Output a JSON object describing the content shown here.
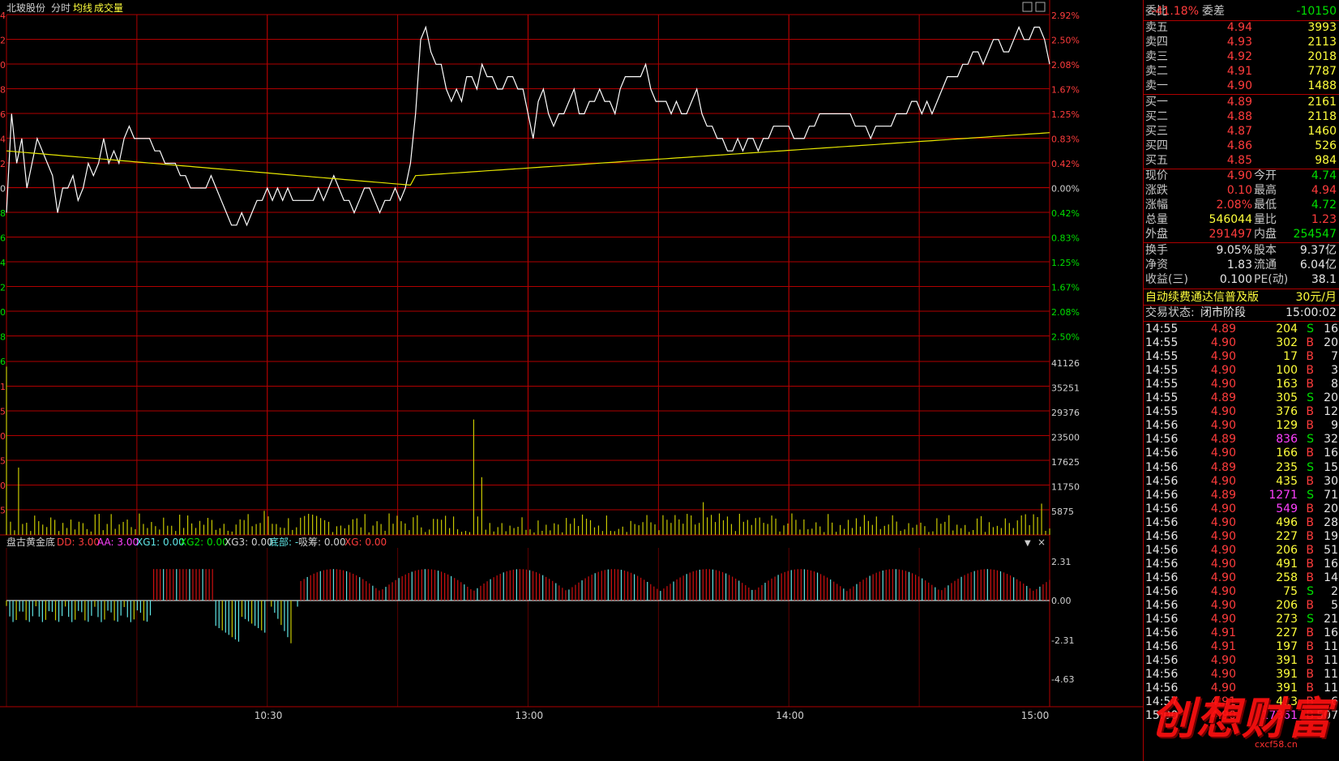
{
  "header": {
    "stock_name": "北玻股份",
    "tab_intraday": "分时",
    "avg_line_label": "均线",
    "volume_label": "成交量"
  },
  "indicator": {
    "name": "盘古黄金底",
    "dd": "DD: 3.00",
    "aa": "AA: 3.00",
    "xg1": "XG1: 0.00",
    "xg2": "XG2: 0.00",
    "xg3": "XG3: 0.00",
    "bottom": "底部: -",
    "absorb": "吸筹: 0.00",
    "xg": "XG: 0.00",
    "axis": [
      "2.31",
      "0.00",
      "-2.31",
      "-4.63"
    ]
  },
  "time_axis": [
    "10:30",
    "13:00",
    "14:00",
    "15:00"
  ],
  "price_axis_left": [
    "4",
    "2",
    "0",
    "8",
    "6",
    "4",
    "2",
    "0",
    "8",
    "6",
    "4",
    "2",
    "0",
    "8",
    "6"
  ],
  "pct_axis": [
    "2.92%",
    "2.50%",
    "2.08%",
    "1.67%",
    "1.25%",
    "0.83%",
    "0.42%",
    "0.00%",
    "0.42%",
    "0.83%",
    "1.25%",
    "1.67%",
    "2.08%",
    "2.50%"
  ],
  "volume_axis": [
    "41126",
    "35251",
    "29376",
    "23500",
    "17625",
    "11750",
    "5875"
  ],
  "volume_axis_left": [
    "1",
    "5",
    "0",
    "5",
    "0",
    "5"
  ],
  "chart_data": {
    "type": "line",
    "price_series_name": "分时",
    "avg_series_name": "均线",
    "base_price": 4.8,
    "price": [
      4.78,
      4.86,
      4.82,
      4.84,
      4.8,
      4.82,
      4.84,
      4.83,
      4.82,
      4.81,
      4.78,
      4.8,
      4.8,
      4.81,
      4.79,
      4.8,
      4.82,
      4.81,
      4.82,
      4.84,
      4.82,
      4.83,
      4.82,
      4.84,
      4.85,
      4.84,
      4.84,
      4.84,
      4.84,
      4.83,
      4.83,
      4.82,
      4.82,
      4.82,
      4.81,
      4.81,
      4.8,
      4.8,
      4.8,
      4.8,
      4.81,
      4.8,
      4.79,
      4.78,
      4.77,
      4.77,
      4.78,
      4.77,
      4.78,
      4.79,
      4.79,
      4.8,
      4.79,
      4.8,
      4.79,
      4.8,
      4.79,
      4.79,
      4.79,
      4.79,
      4.79,
      4.8,
      4.79,
      4.8,
      4.81,
      4.8,
      4.79,
      4.79,
      4.78,
      4.79,
      4.8,
      4.8,
      4.79,
      4.78,
      4.79,
      4.79,
      4.8,
      4.79,
      4.8,
      4.82,
      4.86,
      4.92,
      4.93,
      4.91,
      4.9,
      4.9,
      4.88,
      4.87,
      4.88,
      4.87,
      4.89,
      4.89,
      4.88,
      4.9,
      4.89,
      4.89,
      4.88,
      4.88,
      4.89,
      4.89,
      4.88,
      4.88,
      4.86,
      4.84,
      4.87,
      4.88,
      4.86,
      4.85,
      4.86,
      4.86,
      4.87,
      4.88,
      4.86,
      4.86,
      4.87,
      4.87,
      4.88,
      4.87,
      4.87,
      4.86,
      4.88,
      4.89,
      4.89,
      4.89,
      4.89,
      4.9,
      4.88,
      4.87,
      4.87,
      4.87,
      4.86,
      4.87,
      4.86,
      4.86,
      4.87,
      4.88,
      4.86,
      4.85,
      4.85,
      4.84,
      4.84,
      4.83,
      4.83,
      4.84,
      4.83,
      4.84,
      4.84,
      4.83,
      4.84,
      4.84,
      4.85,
      4.85,
      4.85,
      4.85,
      4.84,
      4.84,
      4.84,
      4.85,
      4.85,
      4.86,
      4.86,
      4.86,
      4.86,
      4.86,
      4.86,
      4.86,
      4.85,
      4.85,
      4.85,
      4.84,
      4.85,
      4.85,
      4.85,
      4.85,
      4.86,
      4.86,
      4.86,
      4.87,
      4.87,
      4.86,
      4.87,
      4.86,
      4.87,
      4.88,
      4.89,
      4.89,
      4.89,
      4.9,
      4.9,
      4.91,
      4.91,
      4.9,
      4.91,
      4.92,
      4.92,
      4.91,
      4.91,
      4.92,
      4.93,
      4.92,
      4.92,
      4.93,
      4.93,
      4.92,
      4.9
    ],
    "avg_start": 4.83,
    "avg_end": 4.835,
    "pct_ticks": [
      2.92,
      2.5,
      2.08,
      1.67,
      1.25,
      0.83,
      0.42,
      0.0,
      -0.42,
      -0.83,
      -1.25,
      -1.67,
      -2.08,
      -2.5
    ],
    "volume_max": 41126
  },
  "sidebar": {
    "weibi_label": "委比",
    "weibi_value": "-41.18%",
    "weicha_label": "委差",
    "weicha_value": "-10150",
    "sells": [
      {
        "label": "卖五",
        "price": "4.94",
        "vol": "3993"
      },
      {
        "label": "卖四",
        "price": "4.93",
        "vol": "2113"
      },
      {
        "label": "卖三",
        "price": "4.92",
        "vol": "2018"
      },
      {
        "label": "卖二",
        "price": "4.91",
        "vol": "7787"
      },
      {
        "label": "卖一",
        "price": "4.90",
        "vol": "1488"
      }
    ],
    "buys": [
      {
        "label": "买一",
        "price": "4.89",
        "vol": "2161"
      },
      {
        "label": "买二",
        "price": "4.88",
        "vol": "2118"
      },
      {
        "label": "买三",
        "price": "4.87",
        "vol": "1460"
      },
      {
        "label": "买四",
        "price": "4.86",
        "vol": "526"
      },
      {
        "label": "买五",
        "price": "4.85",
        "vol": "984"
      }
    ],
    "stats": [
      {
        "l1": "现价",
        "v1": "4.90",
        "c1": "red",
        "l2": "今开",
        "v2": "4.74",
        "c2": "green"
      },
      {
        "l1": "涨跌",
        "v1": "0.10",
        "c1": "red",
        "l2": "最高",
        "v2": "4.94",
        "c2": "red"
      },
      {
        "l1": "涨幅",
        "v1": "2.08%",
        "c1": "red",
        "l2": "最低",
        "v2": "4.72",
        "c2": "green"
      },
      {
        "l1": "总量",
        "v1": "546044",
        "c1": "yel",
        "l2": "量比",
        "v2": "1.23",
        "c2": "red"
      },
      {
        "l1": "外盘",
        "v1": "291497",
        "c1": "red",
        "l2": "内盘",
        "v2": "254547",
        "c2": "green"
      }
    ],
    "stats2": [
      {
        "l1": "换手",
        "v1": "9.05%",
        "l2": "股本",
        "v2": "9.37亿"
      },
      {
        "l1": "净资",
        "v1": "1.83",
        "l2": "流通",
        "v2": "6.04亿"
      },
      {
        "l1": "收益(三)",
        "v1": "0.100",
        "l2": "PE(动)",
        "v2": "38.1"
      }
    ],
    "ad_text": "自动续费通达信普及版",
    "ad_price": "30元/月",
    "trade_status_label": "交易状态:",
    "trade_status_value": "闭市阶段",
    "trade_status_time": "15:00:02",
    "ticks": [
      {
        "t": "14:55",
        "p": "4.89",
        "v": "204",
        "s": "S",
        "n": "16"
      },
      {
        "t": "14:55",
        "p": "4.90",
        "v": "302",
        "s": "B",
        "n": "20"
      },
      {
        "t": "14:55",
        "p": "4.90",
        "v": "17",
        "s": "B",
        "n": "7"
      },
      {
        "t": "14:55",
        "p": "4.90",
        "v": "100",
        "s": "B",
        "n": "3"
      },
      {
        "t": "14:55",
        "p": "4.90",
        "v": "163",
        "s": "B",
        "n": "8"
      },
      {
        "t": "14:55",
        "p": "4.89",
        "v": "305",
        "s": "S",
        "n": "20"
      },
      {
        "t": "14:55",
        "p": "4.90",
        "v": "376",
        "s": "B",
        "n": "12"
      },
      {
        "t": "14:56",
        "p": "4.90",
        "v": "129",
        "s": "B",
        "n": "9"
      },
      {
        "t": "14:56",
        "p": "4.89",
        "v": "836",
        "s": "S",
        "n": "32"
      },
      {
        "t": "14:56",
        "p": "4.90",
        "v": "166",
        "s": "B",
        "n": "16"
      },
      {
        "t": "14:56",
        "p": "4.89",
        "v": "235",
        "s": "S",
        "n": "15"
      },
      {
        "t": "14:56",
        "p": "4.90",
        "v": "435",
        "s": "B",
        "n": "30"
      },
      {
        "t": "14:56",
        "p": "4.89",
        "v": "1271",
        "s": "S",
        "n": "71"
      },
      {
        "t": "14:56",
        "p": "4.90",
        "v": "549",
        "s": "B",
        "n": "20"
      },
      {
        "t": "14:56",
        "p": "4.90",
        "v": "496",
        "s": "B",
        "n": "28"
      },
      {
        "t": "14:56",
        "p": "4.90",
        "v": "227",
        "s": "B",
        "n": "19"
      },
      {
        "t": "14:56",
        "p": "4.90",
        "v": "206",
        "s": "B",
        "n": "51"
      },
      {
        "t": "14:56",
        "p": "4.90",
        "v": "491",
        "s": "B",
        "n": "16"
      },
      {
        "t": "14:56",
        "p": "4.90",
        "v": "258",
        "s": "B",
        "n": "14"
      },
      {
        "t": "14:56",
        "p": "4.90",
        "v": "75",
        "s": "S",
        "n": "2"
      },
      {
        "t": "14:56",
        "p": "4.90",
        "v": "206",
        "s": "B",
        "n": "5"
      },
      {
        "t": "14:56",
        "p": "4.90",
        "v": "273",
        "s": "S",
        "n": "21"
      },
      {
        "t": "14:56",
        "p": "4.91",
        "v": "227",
        "s": "B",
        "n": "16"
      },
      {
        "t": "14:56",
        "p": "4.91",
        "v": "197",
        "s": "B",
        "n": "11"
      },
      {
        "t": "14:56",
        "p": "4.90",
        "v": "391",
        "s": "B",
        "n": "11"
      },
      {
        "t": "14:56",
        "p": "4.90",
        "v": "391",
        "s": "B",
        "n": "11"
      },
      {
        "t": "14:56",
        "p": "4.90",
        "v": "391",
        "s": "B",
        "n": "11"
      },
      {
        "t": "14:57",
        "p": "4.91",
        "v": "413",
        "s": "B",
        "n": "6"
      },
      {
        "t": "15:00",
        "p": "4.90",
        "v": "17361",
        "s": "B",
        "n": "507"
      }
    ]
  },
  "watermark": {
    "text": "创想财富",
    "sub": "cxcf58.cn"
  },
  "colors": {
    "grid": "#b00000",
    "price": "#ffffff",
    "avg": "#e6e600",
    "vol": "#c8c800",
    "cyan": "#5fe6e6",
    "red_bar": "#d01010",
    "magenta": "#ff40ff"
  }
}
